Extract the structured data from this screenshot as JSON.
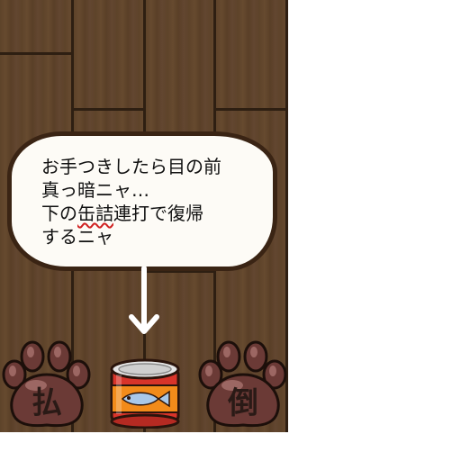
{
  "dialog": {
    "lines": [
      {
        "segments": [
          {
            "text": "お手つきしたら目の前"
          }
        ]
      },
      {
        "segments": [
          {
            "text": "真っ暗ニャ…"
          }
        ]
      },
      {
        "segments": [
          {
            "text": "下の"
          },
          {
            "text": "缶詰",
            "mark": "wavy-underline"
          },
          {
            "text": "連打で復帰"
          }
        ]
      },
      {
        "segments": [
          {
            "text": "するニャ"
          }
        ]
      }
    ]
  },
  "buttons": {
    "left_label": "払",
    "right_label": "倒"
  },
  "icons": {
    "arrow": "down-arrow-icon",
    "can": "fish-can-icon",
    "left_button": "paw-icon",
    "right_button": "paw-icon"
  },
  "colors": {
    "floor": "#5b4128",
    "bubble_fill": "#fdfbf6",
    "bubble_border": "#3a2414",
    "underline": "#d02020",
    "paw": "#6b3a36",
    "can_red": "#d8342a",
    "can_label": "#f28b1a",
    "fish": "#a9c8e8"
  }
}
